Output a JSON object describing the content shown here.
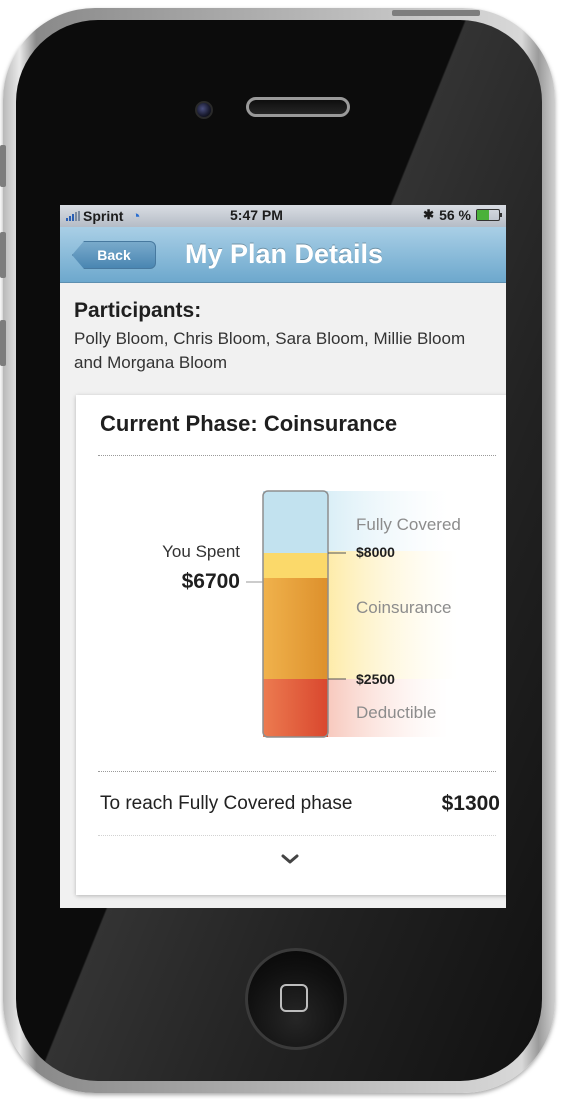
{
  "status_bar": {
    "carrier": "Sprint",
    "time": "5:47 PM",
    "battery_percent": "56 %",
    "battery_level": 0.56,
    "icons": [
      "signal-bars-icon",
      "wifi-icon",
      "bluetooth-icon",
      "battery-charging-icon"
    ]
  },
  "nav": {
    "back_label": "Back",
    "title": "My Plan Details"
  },
  "participants": {
    "heading": "Participants:",
    "names": "Polly Bloom, Chris Bloom, Sara Bloom, Millie Bloom and Morgana Bloom"
  },
  "phase_card": {
    "title": "Current Phase: Coinsurance",
    "you_spent_label": "You Spent",
    "you_spent_value": "$6700",
    "phases": {
      "fully_covered": "Fully Covered",
      "coinsurance": "Coinsurance",
      "deductible": "Deductible"
    },
    "thresholds": {
      "coinsurance_max_label": "$8000",
      "deductible_max_label": "$2500"
    },
    "reach_label": "To reach Fully Covered phase",
    "reach_value": "$1300",
    "expand_icon": "chevron-down-icon"
  },
  "colors": {
    "nav_bar": "#6da8cd",
    "fully_covered": "#c2e2ef",
    "spent_marker": "#fbd96a",
    "coinsurance": "#e9a23b",
    "deductible": "#e0573a"
  },
  "chart_data": {
    "type": "bar",
    "orientation": "vertical stacked gauge",
    "categories": [
      "Deductible",
      "Coinsurance",
      "Fully Covered"
    ],
    "thresholds": [
      2500,
      8000
    ],
    "current_spent": 6700,
    "remaining_to_fully_covered": 1300
  }
}
